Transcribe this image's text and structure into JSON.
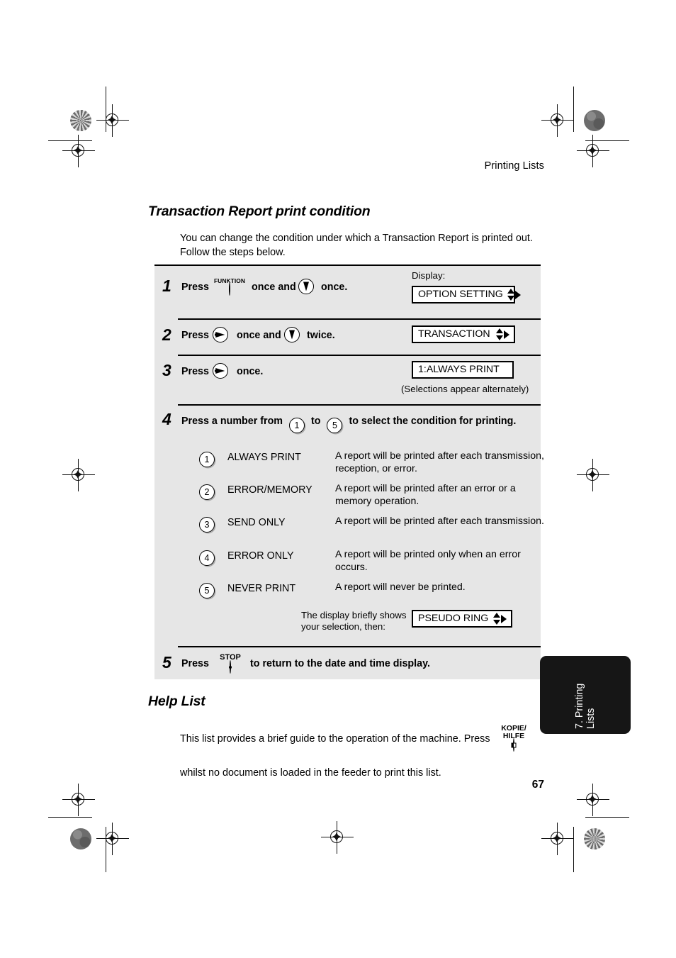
{
  "page": {
    "running_head": "Printing Lists",
    "page_number": "67",
    "side_tab": "7. Printing\nLists",
    "side_tab_line1": "7. Printing",
    "side_tab_line2": "Lists"
  },
  "transaction_section": {
    "title": "Transaction Report print condition",
    "intro": "You can change the condition under which a Transaction Report is printed out. Follow the steps below.",
    "display_label": "Display:",
    "note_alternately": "(Selections appear alternately)",
    "brief_note_line1": "The display briefly shows",
    "brief_note_line2": "your selection, then:",
    "steps": [
      {
        "num": "1",
        "press_label": "Press",
        "icon1": "funktion-button-icon",
        "icon1_caption": "FUNKTION",
        "mid_text": "once and",
        "icon2": "down-arrow-key-icon",
        "tail_text": "once.",
        "display": "OPTION SETTING",
        "display_arrows": "up-down-right"
      },
      {
        "num": "2",
        "press_label": "Press",
        "icon1": "right-arrow-key-icon",
        "mid_text": "once and",
        "icon2": "down-arrow-key-icon",
        "tail_text": "twice.",
        "display": "TRANSACTION",
        "display_arrows": "up-down-right"
      },
      {
        "num": "3",
        "press_label": "Press",
        "icon1": "right-arrow-key-icon",
        "tail_text": "once.",
        "display": "1:ALWAYS PRINT",
        "display_arrows": "none"
      },
      {
        "num": "4",
        "text_a": "Press a number from",
        "key_from": "1",
        "text_b": "to",
        "key_to": "5",
        "text_c": "to select the condition for printing.",
        "display": "PSEUDO RING",
        "display_arrows": "up-down-right"
      },
      {
        "num": "5",
        "press_label": "Press",
        "icon1": "stop-button-icon",
        "icon1_caption": "STOP",
        "tail_text": "to return to the date and time display."
      }
    ],
    "options": [
      {
        "key": "1",
        "name": "ALWAYS PRINT",
        "desc": "A report will be printed after each transmission, reception, or error."
      },
      {
        "key": "2",
        "name": "ERROR/MEMORY",
        "desc": "A report will be printed after an error or a memory operation."
      },
      {
        "key": "3",
        "name": "SEND ONLY",
        "desc": "A report will be printed after each transmission."
      },
      {
        "key": "4",
        "name": "ERROR ONLY",
        "desc": "A report will be printed only when an error occurs."
      },
      {
        "key": "5",
        "name": "NEVER PRINT",
        "desc": "A report will never be printed."
      }
    ]
  },
  "help_section": {
    "title": "Help List",
    "body_line1": "This list provides a brief guide to the operation of the machine. Press",
    "body_line2": "whilst no document is loaded in the feeder to print this list.",
    "button_caption_line1": "KOPIE/",
    "button_caption_line2": "HILFE",
    "button_icon": "kopie-hilfe-button-icon"
  },
  "colors": {
    "panel_background": "#e6e6e6",
    "side_tab_background": "#161616",
    "text": "#000000",
    "page_background": "#ffffff"
  }
}
